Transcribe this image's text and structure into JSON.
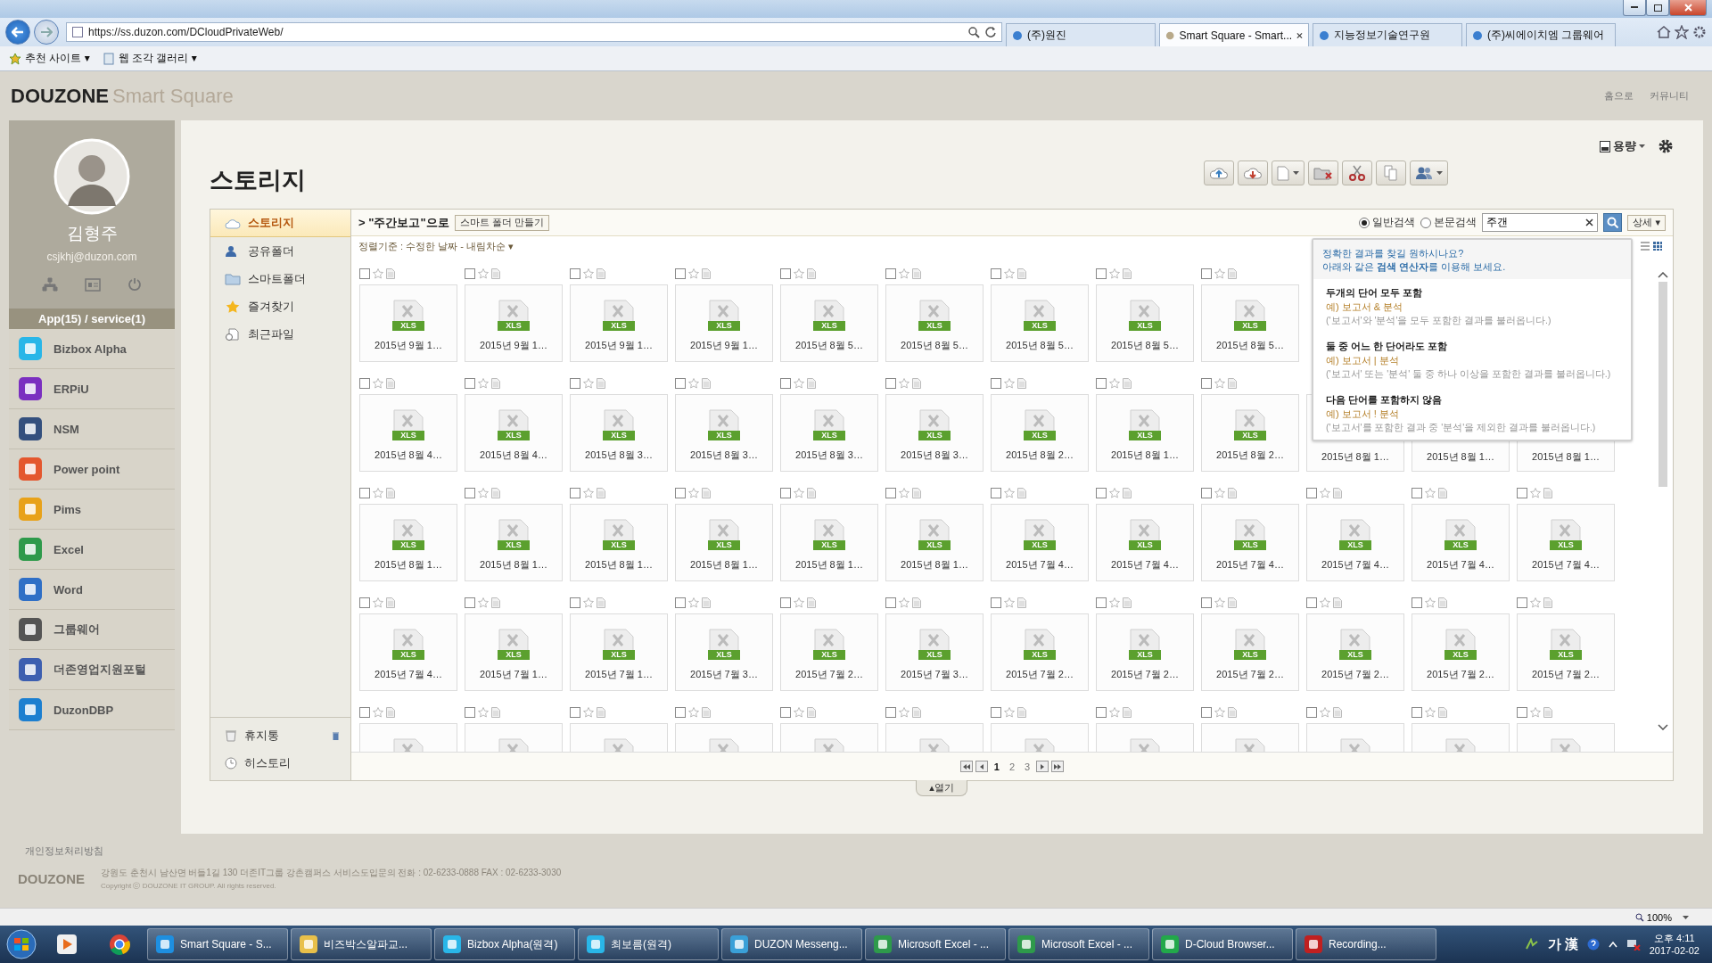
{
  "browser": {
    "address": "https://ss.duzon.com/DCloudPrivateWeb/",
    "tabs": [
      {
        "label": "(주)원진",
        "selected": false
      },
      {
        "label": "Smart Square - Smart...",
        "selected": true
      },
      {
        "label": "지능정보기술연구원",
        "selected": false
      },
      {
        "label": "(주)씨에이치엠 그룹웨어",
        "selected": false
      }
    ],
    "favorites": [
      "추천 사이트 ▾",
      "웹 조각 갤러리 ▾"
    ],
    "zoom": "100%"
  },
  "header": {
    "logo_main": "DOUZONE",
    "logo_sub": "Smart Square",
    "links": [
      "홈으로",
      "커뮤니티"
    ]
  },
  "profile": {
    "name": "김형주",
    "email": "csjkhj@duzon.com",
    "app_count": "App(15) / service(1)",
    "apps": [
      {
        "name": "Bizbox Alpha",
        "color": "#29b6e8"
      },
      {
        "name": "ERPiU",
        "color": "#7b2fc0"
      },
      {
        "name": "NSM",
        "color": "#34507e"
      },
      {
        "name": "Power point",
        "color": "#e4572e"
      },
      {
        "name": "Pims",
        "color": "#e8a21a"
      },
      {
        "name": "Excel",
        "color": "#2e9a4b"
      },
      {
        "name": "Word",
        "color": "#2f6fc6"
      },
      {
        "name": "그룹웨어",
        "color": "#555555"
      },
      {
        "name": "더존영업지원포털",
        "color": "#3d5fb0"
      },
      {
        "name": "DuzonDBP",
        "color": "#1c7fd0"
      }
    ]
  },
  "storage": {
    "title": "스토리지",
    "capacity": "용량",
    "nav": [
      {
        "label": "스토리지",
        "selected": true
      },
      {
        "label": "공유폴더",
        "selected": false
      },
      {
        "label": "스마트폴더",
        "selected": false
      },
      {
        "label": "즐겨찾기",
        "selected": false
      },
      {
        "label": "최근파일",
        "selected": false
      }
    ],
    "nav_bottom": [
      "휴지통",
      "히스토리"
    ],
    "breadcrumb_arrow": ">",
    "breadcrumb": "\"주간보고\"으로",
    "smart_folder_button": "스마트 폴더 만들기",
    "search_modes": [
      {
        "label": "일반검색",
        "selected": true
      },
      {
        "label": "본문검색",
        "selected": false
      }
    ],
    "search_value": "주갠",
    "detail_button": "상세 ▾",
    "sort": "정렬기준 : 수정한 날짜 - 내림차순 ▾",
    "rows": [
      [
        {
          "label": "2015년 9월 1…",
          "badge": "XLS",
          "checked": false
        },
        {
          "label": "2015년 9월 1…",
          "badge": "XLS",
          "checked": false
        },
        {
          "label": "2015년 9월 1…",
          "badge": "XLS",
          "checked": false
        },
        {
          "label": "2015년 9월 1…",
          "badge": "XLS",
          "checked": false
        },
        {
          "label": "2015년 8월 5…",
          "badge": "XLS",
          "checked": false
        },
        {
          "label": "2015년 8월 5…",
          "badge": "XLS",
          "checked": false
        },
        {
          "label": "2015년 8월 5…",
          "badge": "XLS",
          "checked": false
        },
        {
          "label": "2015년 8월 5…",
          "badge": "XLS",
          "checked": false
        },
        {
          "label": "2015년 8월 5…",
          "badge": "XLS",
          "checked": false
        }
      ],
      [
        {
          "label": "2015년 8월 4…",
          "badge": "XLS",
          "checked": false
        },
        {
          "label": "2015년 8월 4…",
          "badge": "XLS",
          "checked": false
        },
        {
          "label": "2015년 8월 3…",
          "badge": "XLS",
          "checked": false
        },
        {
          "label": "2015년 8월 3…",
          "badge": "XLS",
          "checked": false
        },
        {
          "label": "2015년 8월 3…",
          "badge": "XLS",
          "checked": false
        },
        {
          "label": "2015년 8월 3…",
          "badge": "XLS",
          "checked": false
        },
        {
          "label": "2015년 8월 2…",
          "badge": "XLS",
          "checked": false
        },
        {
          "label": "2015년 8월 1…",
          "badge": "XLS",
          "checked": false
        },
        {
          "label": "2015년 8월 2…",
          "badge": "XLS",
          "checked": false
        },
        {
          "label": "2015년 8월 1…"
        },
        {
          "label": "2015년 8월 1…"
        },
        {
          "label": "2015년 8월 1…"
        }
      ],
      [
        {
          "label": "2015년 8월 1…",
          "badge": "XLS",
          "checked": false
        },
        {
          "label": "2015년 8월 1…",
          "badge": "XLS",
          "checked": false
        },
        {
          "label": "2015년 8월 1…",
          "badge": "XLS",
          "checked": false
        },
        {
          "label": "2015년 8월 1…",
          "badge": "XLS",
          "checked": false
        },
        {
          "label": "2015년 8월 1…",
          "badge": "XLS",
          "checked": false
        },
        {
          "label": "2015년 8월 1…",
          "badge": "XLS",
          "checked": false
        },
        {
          "label": "2015년 7월 4…",
          "badge": "XLS",
          "checked": false
        },
        {
          "label": "2015년 7월 4…",
          "badge": "XLS",
          "checked": false
        },
        {
          "label": "2015년 7월 4…",
          "badge": "XLS",
          "checked": false
        },
        {
          "label": "2015년 7월 4…",
          "badge": "XLS",
          "checked": false
        },
        {
          "label": "2015년 7월 4…",
          "badge": "XLS",
          "checked": false
        },
        {
          "label": "2015년 7월 4…",
          "badge": "XLS",
          "checked": false
        }
      ],
      [
        {
          "label": "2015년 7월 4…",
          "badge": "XLS",
          "checked": false
        },
        {
          "label": "2015년 7월 1…",
          "badge": "XLS",
          "checked": false
        },
        {
          "label": "2015년 7월 1…",
          "badge": "XLS",
          "checked": false
        },
        {
          "label": "2015년 7월 3…",
          "badge": "XLS",
          "checked": false
        },
        {
          "label": "2015년 7월 2…",
          "badge": "XLS",
          "checked": false
        },
        {
          "label": "2015년 7월 3…",
          "badge": "XLS",
          "checked": false
        },
        {
          "label": "2015년 7월 2…",
          "badge": "XLS",
          "checked": false
        },
        {
          "label": "2015년 7월 2…",
          "badge": "XLS",
          "checked": false
        },
        {
          "label": "2015년 7월 2…",
          "badge": "XLS",
          "checked": false
        },
        {
          "label": "2015년 7월 2…",
          "badge": "XLS",
          "checked": false
        },
        {
          "label": "2015년 7월 2…",
          "badge": "XLS",
          "checked": false
        },
        {
          "label": "2015년 7월 2…",
          "badge": "XLS",
          "checked": false
        }
      ],
      [
        {
          "checked": false
        },
        {
          "checked": false
        },
        {
          "checked": false
        },
        {
          "checked": false
        },
        {
          "checked": false
        },
        {
          "checked": false
        },
        {
          "checked": false
        },
        {
          "checked": false
        },
        {
          "checked": false
        },
        {
          "checked": false
        },
        {
          "checked": false
        },
        {
          "checked": false
        }
      ]
    ],
    "pages": [
      {
        "label": "1",
        "selected": true
      },
      {
        "label": "2",
        "selected": false
      },
      {
        "label": "3",
        "selected": false
      }
    ],
    "open_tab": "▴열기",
    "search_help": {
      "intro": [
        "정확한 결과를 찾길 원하시나요?",
        "아래와 같은 **검색 연산자**를 이용해 보세요."
      ],
      "operators": [
        {
          "title": "두개의 단어 모두 포함",
          "example": "예) 보고서 & 분석",
          "description": "('보고서'와 '분석'을 모두 포함한 결과를 불러옵니다.)"
        },
        {
          "title": "둘 중 어느 한 단어라도 포함",
          "example": "예) 보고서 | 분석",
          "description": "('보고서' 또는 '분석' 둘 중 하나 이상을 포함한 결과를 불러옵니다.)"
        },
        {
          "title": "다음 단어를 포함하지 않음",
          "example": "예) 보고서 ! 분석",
          "description": "('보고서'를 포함한 결과 중 '분석'을 제외한 결과를 불러옵니다.)"
        }
      ]
    }
  },
  "footer": {
    "privacy": "개인정보처리방침",
    "logo": "DOUZONE",
    "address": "강원도 춘천시 남산면 버들1길 130 더존IT그룹 강촌캠퍼스   서비스도입문의 전화 : 02-6233-0888   FAX : 02-6233-3030",
    "copyright": "Copyright ⓒ DOUZONE IT GROUP. All rights reserved."
  },
  "taskbar": {
    "tasks": [
      {
        "label": "Smart Square - S...",
        "color": "#1e8fe0"
      },
      {
        "label": "비즈박스알파교...",
        "color": "#e8c04a"
      },
      {
        "label": "Bizbox Alpha(원격)",
        "color": "#29b6e8"
      },
      {
        "label": "최보름(원격)",
        "color": "#29b6e8"
      },
      {
        "label": "DUZON Messeng...",
        "color": "#3aa0d8"
      },
      {
        "label": "Microsoft Excel - ...",
        "color": "#2e9a4b"
      },
      {
        "label": "Microsoft Excel - ...",
        "color": "#2e9a4b"
      },
      {
        "label": "D-Cloud Browser...",
        "color": "#22a84a"
      },
      {
        "label": "Recording...",
        "color": "#c02020"
      }
    ],
    "ime": "가 漢",
    "time": "오후 4:11",
    "date": "2017-02-02"
  }
}
